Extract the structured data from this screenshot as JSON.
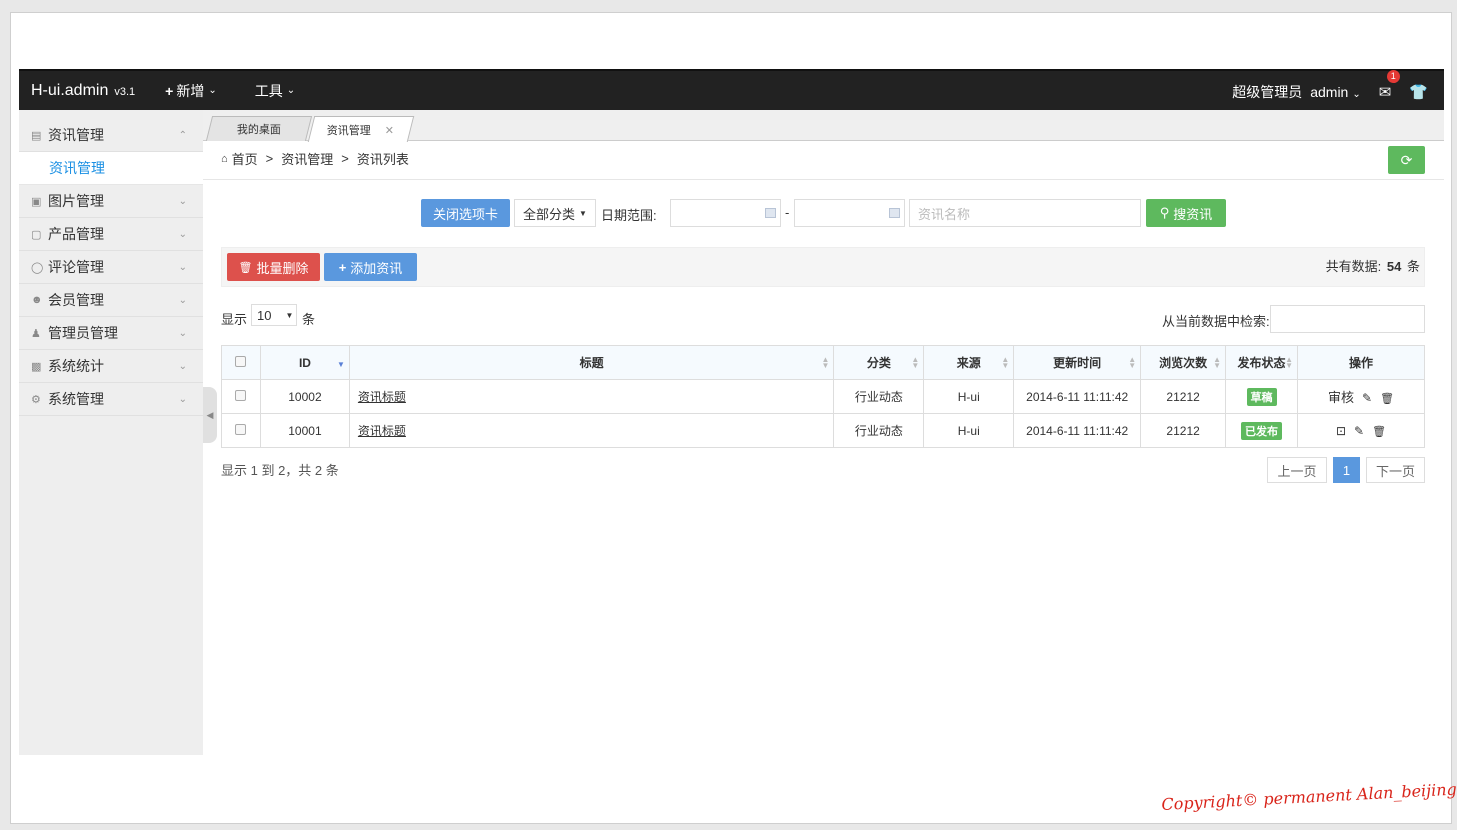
{
  "topbar": {
    "brand": "H-ui.admin",
    "version": "v3.1",
    "menu_new": "新增",
    "menu_tools": "工具",
    "role": "超级管理员",
    "user": "admin",
    "mail_badge": "1"
  },
  "sidebar": {
    "groups": [
      {
        "label": "资讯管理",
        "icon": "news-icon"
      },
      {
        "label": "图片管理",
        "icon": "image-icon"
      },
      {
        "label": "产品管理",
        "icon": "product-icon"
      },
      {
        "label": "评论管理",
        "icon": "comment-icon"
      },
      {
        "label": "会员管理",
        "icon": "member-icon"
      },
      {
        "label": "管理员管理",
        "icon": "admin-icon"
      },
      {
        "label": "系统统计",
        "icon": "stats-icon"
      },
      {
        "label": "系统管理",
        "icon": "settings-icon"
      }
    ],
    "active_sub": "资讯管理"
  },
  "tabs": {
    "desktop": "我的桌面",
    "news": "资讯管理"
  },
  "breadcrumb": {
    "home": "首页",
    "level1": "资讯管理",
    "level2": "资讯列表"
  },
  "search": {
    "close_tabs": "关闭选项卡",
    "category": "全部分类",
    "date_label": "日期范围:",
    "date_sep": "-",
    "name_placeholder": "资讯名称",
    "search_btn": "搜资讯"
  },
  "toolbar": {
    "batch_delete": "批量删除",
    "add_news": "添加资讯",
    "total_prefix": "共有数据:",
    "total_count": "54",
    "total_suffix": "条"
  },
  "listctrl": {
    "show": "显示",
    "page_size": "10",
    "unit": "条",
    "filter_label": "从当前数据中检索:"
  },
  "table": {
    "headers": [
      "ID",
      "标题",
      "分类",
      "来源",
      "更新时间",
      "浏览次数",
      "发布状态",
      "操作"
    ],
    "rows": [
      {
        "id": "10002",
        "title": "资讯标题",
        "category": "行业动态",
        "source": "H-ui",
        "updated": "2014-6-11 11:11:42",
        "views": "21212",
        "status": "草稿",
        "op_text": "审核"
      },
      {
        "id": "10001",
        "title": "资讯标题",
        "category": "行业动态",
        "source": "H-ui",
        "updated": "2014-6-11 11:11:42",
        "views": "21212",
        "status": "已发布",
        "op_text": ""
      }
    ]
  },
  "pagination": {
    "info": "显示 1 到 2，共 2 条",
    "prev": "上一页",
    "current": "1",
    "next": "下一页"
  },
  "watermark": "Copyright© permanent  Alan_beijing"
}
